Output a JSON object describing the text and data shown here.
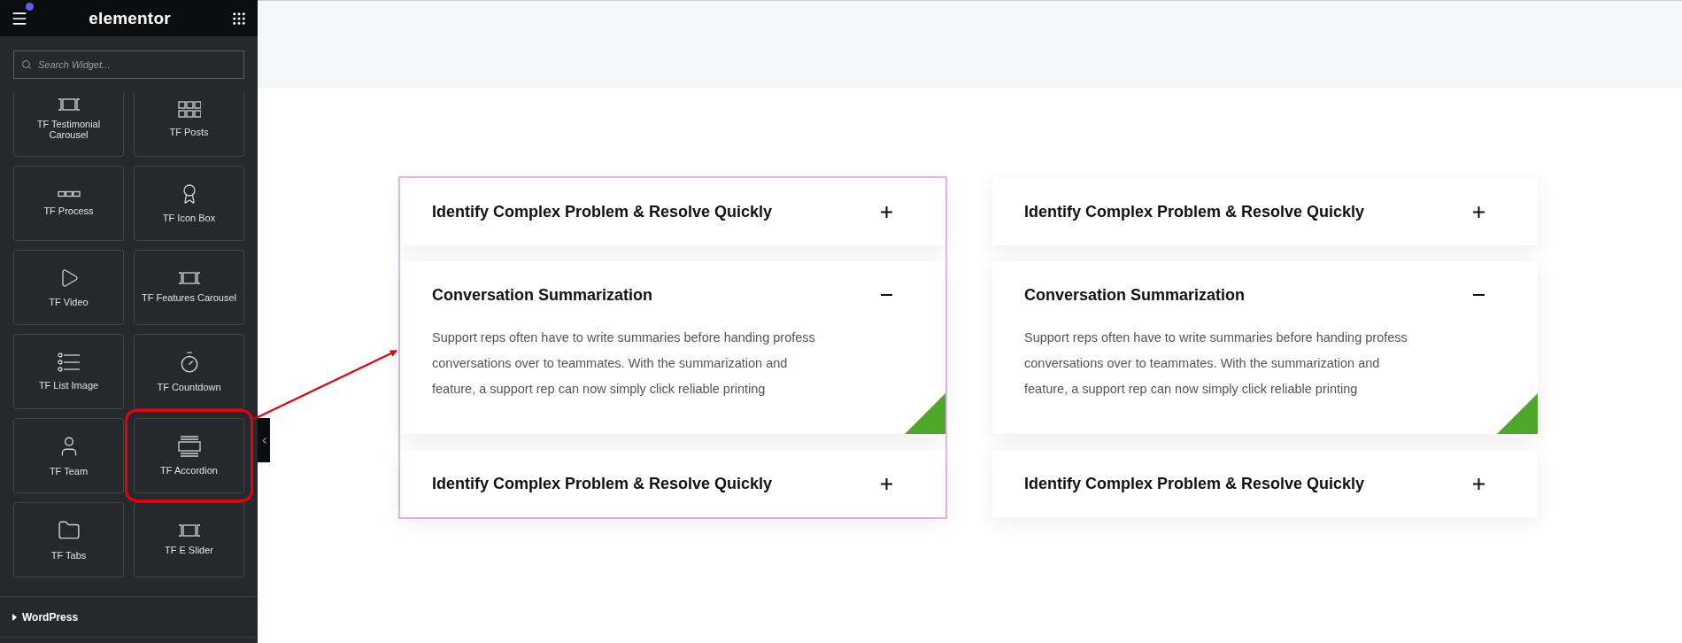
{
  "sidebar": {
    "logo": "elementor",
    "notification": true,
    "search": {
      "placeholder": "Search Widget..."
    },
    "widgets": [
      {
        "label": "TF Testimonial Carousel",
        "kind": "film",
        "highlighted": false
      },
      {
        "label": "TF Posts",
        "kind": "grid",
        "highlighted": false
      },
      {
        "label": "TF Process",
        "kind": "steps",
        "highlighted": false
      },
      {
        "label": "TF Icon Box",
        "kind": "badge",
        "highlighted": false
      },
      {
        "label": "TF Video",
        "kind": "play",
        "highlighted": false
      },
      {
        "label": "TF Features Carousel",
        "kind": "film",
        "highlighted": false
      },
      {
        "label": "TF List Image",
        "kind": "list",
        "highlighted": false
      },
      {
        "label": "TF Countdown",
        "kind": "timer",
        "highlighted": false
      },
      {
        "label": "TF Team",
        "kind": "person",
        "highlighted": false
      },
      {
        "label": "TF Accordion",
        "kind": "layers",
        "highlighted": true
      },
      {
        "label": "TF Tabs",
        "kind": "folder",
        "highlighted": false
      },
      {
        "label": "TF E Slider",
        "kind": "film",
        "highlighted": false
      }
    ],
    "sections": [
      {
        "label": "WordPress",
        "expanded": false
      }
    ]
  },
  "accordions": [
    {
      "selected": true,
      "items": [
        {
          "title": "Identify Complex Problem & Resolve Quickly",
          "expanded": false
        },
        {
          "title": "Conversation Summarization",
          "expanded": true,
          "body": "Support reps often have to write summaries before handing profess conversations over to teammates. With the summarization and feature, a support rep can now simply click reliable printing"
        },
        {
          "title": "Identify Complex Problem & Resolve Quickly",
          "expanded": false
        }
      ]
    },
    {
      "selected": false,
      "items": [
        {
          "title": "Identify Complex Problem & Resolve Quickly",
          "expanded": false
        },
        {
          "title": "Conversation Summarization",
          "expanded": true,
          "body": "Support reps often have to write summaries before handing profess conversations over to teammates. With the summarization and feature, a support rep can now simply click reliable printing"
        },
        {
          "title": "Identify Complex Problem & Resolve Quickly",
          "expanded": false
        }
      ]
    }
  ]
}
